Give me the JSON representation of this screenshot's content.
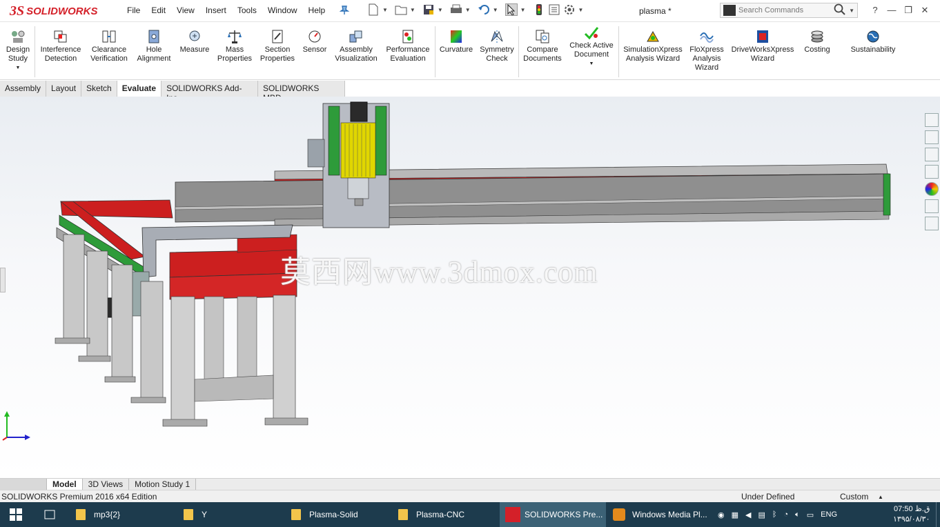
{
  "app": {
    "logo_text": "SOLIDWORKS",
    "document_title": "plasma *"
  },
  "menu": [
    "File",
    "Edit",
    "View",
    "Insert",
    "Tools",
    "Window",
    "Help"
  ],
  "search": {
    "placeholder": "Search Commands"
  },
  "ribbon": {
    "design_study": "Design Study",
    "interference": "Interference Detection",
    "clearance": "Clearance Verification",
    "hole_alignment": "Hole Alignment",
    "measure": "Measure",
    "mass_properties": "Mass Properties",
    "section_properties": "Section Properties",
    "sensor": "Sensor",
    "assembly_visualization": "Assembly Visualization",
    "performance_evaluation": "Performance Evaluation",
    "curvature": "Curvature",
    "symmetry_check": "Symmetry Check",
    "compare_documents": "Compare Documents",
    "check_active_document": "Check Active Document",
    "simulationxpress": "SimulationXpress Analysis Wizard",
    "floxpress": "FloXpress Analysis Wizard",
    "driveworksxpress": "DriveWorksXpress Wizard",
    "costing": "Costing",
    "sustainability": "Sustainability"
  },
  "command_tabs": [
    "Assembly",
    "Layout",
    "Sketch",
    "Evaluate",
    "SOLIDWORKS Add-Ins",
    "SOLIDWORKS MBD"
  ],
  "active_command_tab": "Evaluate",
  "viewport": {
    "watermark": "莫西网www.3dmox.com"
  },
  "bottom_tabs": [
    "Model",
    "3D Views",
    "Motion Study 1"
  ],
  "status": {
    "edition": "SOLIDWORKS Premium 2016 x64 Edition",
    "state": "Under Defined",
    "units": "Custom"
  },
  "taskbar": {
    "items": [
      {
        "label": "mp3{2}"
      },
      {
        "label": "Y"
      },
      {
        "label": "Plasma-Solid"
      },
      {
        "label": "Plasma-CNC"
      },
      {
        "label": "SOLIDWORKS Pre..."
      },
      {
        "label": "Windows Media Pl..."
      }
    ],
    "language": "ENG",
    "time": "07:50 ق.ظ",
    "date": "۱۳۹۵/۰۸/۳۰"
  },
  "colors": {
    "accent_red": "#d42029",
    "taskbar": "#1d3b4d",
    "machine_red": "#cc1f1f",
    "machine_green": "#2e9b3a",
    "frame_gray": "#c8c8c8"
  }
}
